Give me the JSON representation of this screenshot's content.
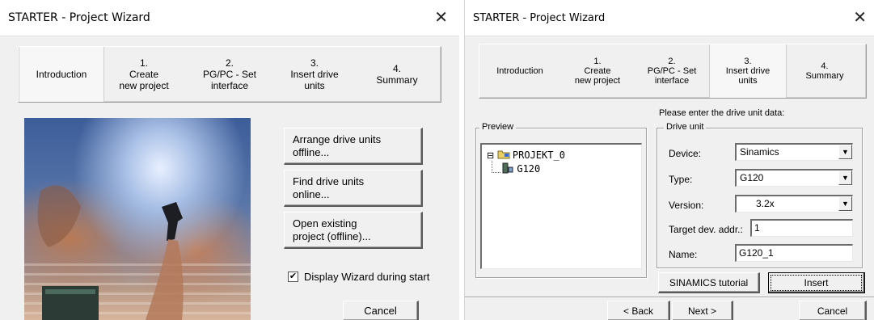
{
  "left_window": {
    "title": "STARTER - Project Wizard",
    "close_glyph": "✕",
    "steps": [
      {
        "num": "",
        "label": "Introduction"
      },
      {
        "num": "1.",
        "label": "Create\nnew project"
      },
      {
        "num": "2.",
        "label": "PG/PC - Set\ninterface"
      },
      {
        "num": "3.",
        "label": "Insert drive\nunits"
      },
      {
        "num": "4.",
        "label": "Summary"
      }
    ],
    "buttons": {
      "arrange": "Arrange drive units\noffline...",
      "find": "Find drive units\nonline...",
      "open": "Open existing\nproject (offline)...",
      "cancel": "Cancel"
    },
    "checkbox": {
      "label": "Display Wizard during start",
      "checked": true,
      "mark": "✔"
    }
  },
  "right_window": {
    "title": "STARTER - Project Wizard",
    "close_glyph": "✕",
    "steps": [
      {
        "num": "",
        "label": "Introduction"
      },
      {
        "num": "1.",
        "label": "Create\nnew project"
      },
      {
        "num": "2.",
        "label": "PG/PC - Set\ninterface"
      },
      {
        "num": "3.",
        "label": "Insert drive\nunits"
      },
      {
        "num": "4.",
        "label": "Summary"
      }
    ],
    "prompt": "Please enter the drive unit data:",
    "preview": {
      "label": "Preview",
      "tree": [
        {
          "name": "PROJEKT_0",
          "expander": "⊟"
        },
        {
          "name": "G120"
        }
      ]
    },
    "drive_unit": {
      "label": "Drive unit",
      "device_label": "Device:",
      "device_value": "Sinamics",
      "type_label": "Type:",
      "type_value": "G120",
      "version_label": "Version:",
      "version_value": "3.2x",
      "target_label": "Target dev. addr.:",
      "target_value": "1",
      "name_label": "Name:",
      "name_value": "G120_1"
    },
    "buttons": {
      "tutorial": "SINAMICS tutorial",
      "insert": "Insert",
      "back": "< Back",
      "next": "Next >",
      "cancel": "Cancel"
    }
  },
  "icons": {
    "dropdown": "▼"
  },
  "colors": {
    "window_bg": "#f0f0f0",
    "titlebar_bg": "#ffffff",
    "tree_bg": "#ffffff"
  }
}
